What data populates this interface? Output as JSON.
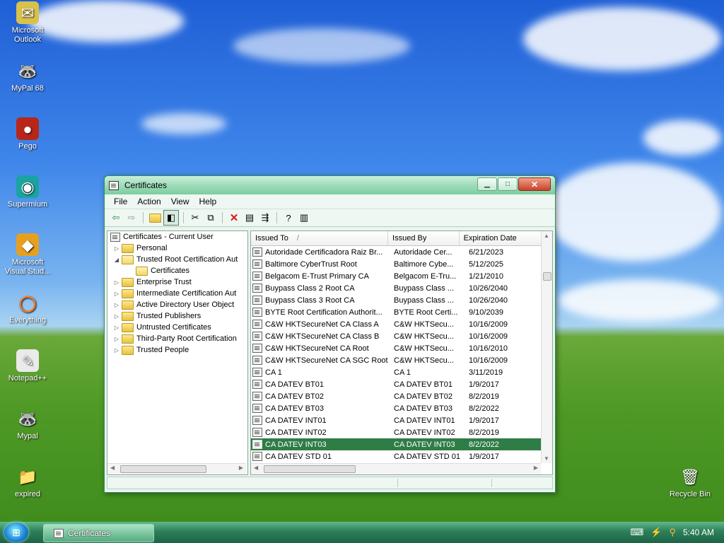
{
  "desktop": {
    "icons": [
      {
        "label": "Microsoft Outlook",
        "icon": "outlook-icon"
      },
      {
        "label": "MyPal 68",
        "icon": "mypal-icon"
      },
      {
        "label": "Pego",
        "icon": "pego-icon"
      },
      {
        "label": "Supermium",
        "icon": "supermium-icon"
      },
      {
        "label": "Microsoft Visual Stud...",
        "icon": "visual-studio-icon"
      },
      {
        "label": "Everything",
        "icon": "everything-icon"
      },
      {
        "label": "Notepad++",
        "icon": "notepad-plus-plus-icon"
      },
      {
        "label": "Mypal",
        "icon": "mypal-icon"
      },
      {
        "label": "expired",
        "icon": "folder-icon"
      }
    ],
    "recycle_bin": "Recycle Bin"
  },
  "window": {
    "title": "Certificates",
    "menu": [
      "File",
      "Action",
      "View",
      "Help"
    ],
    "tree": {
      "root": "Certificates - Current User",
      "items": [
        {
          "label": "Personal",
          "expanded": false
        },
        {
          "label": "Trusted Root Certification Aut",
          "expanded": true,
          "children": [
            "Certificates"
          ]
        },
        {
          "label": "Enterprise Trust",
          "expanded": false
        },
        {
          "label": "Intermediate Certification Aut",
          "expanded": false
        },
        {
          "label": "Active Directory User Object",
          "expanded": false
        },
        {
          "label": "Trusted Publishers",
          "expanded": false
        },
        {
          "label": "Untrusted Certificates",
          "expanded": false
        },
        {
          "label": "Third-Party Root Certification",
          "expanded": false
        },
        {
          "label": "Trusted People",
          "expanded": false
        }
      ]
    },
    "columns": [
      "Issued To",
      "Issued By",
      "Expiration Date"
    ],
    "rows": [
      [
        "Autoridade Certificadora Raiz Br...",
        "Autoridade Cer...",
        "6/21/2023"
      ],
      [
        "Baltimore CyberTrust Root",
        "Baltimore Cybe...",
        "5/12/2025"
      ],
      [
        "Belgacom E-Trust Primary CA",
        "Belgacom E-Tru...",
        "1/21/2010"
      ],
      [
        "Buypass Class 2 Root CA",
        "Buypass Class ...",
        "10/26/2040"
      ],
      [
        "Buypass Class 3 Root CA",
        "Buypass Class ...",
        "10/26/2040"
      ],
      [
        "BYTE Root Certification Authorit...",
        "BYTE Root Certi...",
        "9/10/2039"
      ],
      [
        "C&W HKTSecureNet CA Class A",
        "C&W HKTSecu...",
        "10/16/2009"
      ],
      [
        "C&W HKTSecureNet CA Class B",
        "C&W HKTSecu...",
        "10/16/2009"
      ],
      [
        "C&W HKTSecureNet CA Root",
        "C&W HKTSecu...",
        "10/16/2010"
      ],
      [
        "C&W HKTSecureNet CA SGC Root",
        "C&W HKTSecu...",
        "10/16/2009"
      ],
      [
        "CA 1",
        "CA 1",
        "3/11/2019"
      ],
      [
        "CA DATEV BT01",
        "CA DATEV BT01",
        "1/9/2017"
      ],
      [
        "CA DATEV BT02",
        "CA DATEV BT02",
        "8/2/2019"
      ],
      [
        "CA DATEV BT03",
        "CA DATEV BT03",
        "8/2/2022"
      ],
      [
        "CA DATEV INT01",
        "CA DATEV INT01",
        "1/9/2017"
      ],
      [
        "CA DATEV INT02",
        "CA DATEV INT02",
        "8/2/2019"
      ],
      [
        "CA DATEV INT03",
        "CA DATEV INT03",
        "8/2/2022"
      ],
      [
        "CA DATEV STD 01",
        "CA DATEV STD 01",
        "1/9/2017"
      ]
    ],
    "selected_row": 16
  },
  "taskbar": {
    "task_label": "Certificates",
    "clock": "5:40 AM"
  },
  "colors": {
    "selection": "#2f7d46",
    "taskbar": "#2d7f59"
  }
}
